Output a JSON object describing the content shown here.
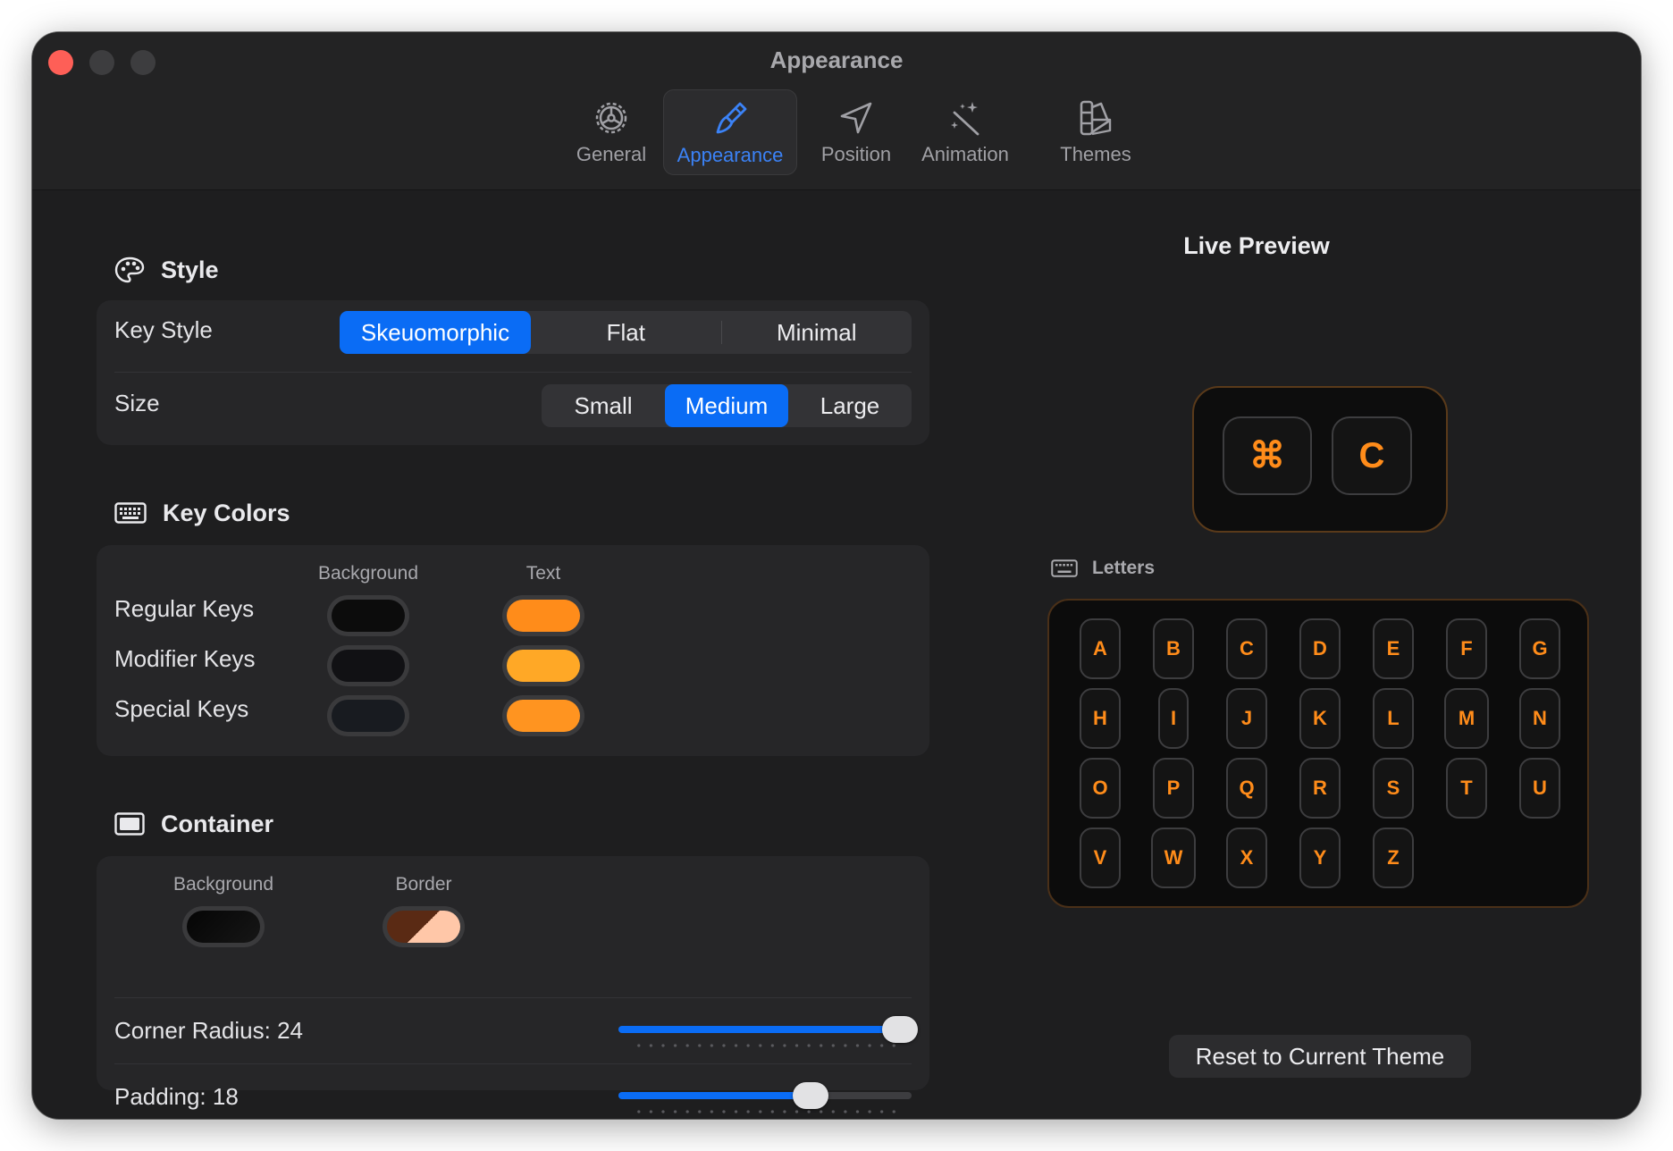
{
  "window": {
    "title": "Appearance"
  },
  "toolbar": {
    "tabs": [
      {
        "label": "General",
        "icon": "gear-icon"
      },
      {
        "label": "Appearance",
        "icon": "paintbrush-icon",
        "active": true
      },
      {
        "label": "Position",
        "icon": "location-arrow-icon"
      },
      {
        "label": "Animation",
        "icon": "magic-wand-icon"
      },
      {
        "label": "Themes",
        "icon": "swatchbook-icon"
      }
    ]
  },
  "style": {
    "title": "Style",
    "key_style": {
      "label": "Key Style",
      "options": [
        "Skeuomorphic",
        "Flat",
        "Minimal"
      ],
      "selected": "Skeuomorphic"
    },
    "size": {
      "label": "Size",
      "options": [
        "Small",
        "Medium",
        "Large"
      ],
      "selected": "Medium"
    }
  },
  "key_colors": {
    "title": "Key Colors",
    "col_background": "Background",
    "col_text": "Text",
    "rows": [
      {
        "label": "Regular Keys",
        "background": "#0c0c0c",
        "text": "#ff8c1a"
      },
      {
        "label": "Modifier Keys",
        "background": "#111114",
        "text": "#ffa826"
      },
      {
        "label": "Special Keys",
        "background": "#181b20",
        "text": "#ff9420"
      }
    ]
  },
  "container": {
    "title": "Container",
    "col_background": "Background",
    "col_border": "Border",
    "background_color": "#0d0d0d",
    "border_color": "#5a3a1a",
    "corner_radius": {
      "label": "Corner Radius: 24",
      "fraction": 1.0
    },
    "padding": {
      "label": "Padding: 18",
      "fraction": 0.67
    }
  },
  "preview": {
    "title": "Live Preview",
    "combo_keys": [
      "⌘",
      "C"
    ],
    "letters_label": "Letters",
    "letters": [
      "A",
      "B",
      "C",
      "D",
      "E",
      "F",
      "G",
      "H",
      "I",
      "J",
      "K",
      "L",
      "M",
      "N",
      "O",
      "P",
      "Q",
      "R",
      "S",
      "T",
      "U",
      "V",
      "W",
      "X",
      "Y",
      "Z"
    ],
    "reset_label": "Reset to Current Theme"
  },
  "colors": {
    "accent": "#0a6cf5",
    "key_text": "#ff8c1a",
    "close": "#fe5f57"
  }
}
